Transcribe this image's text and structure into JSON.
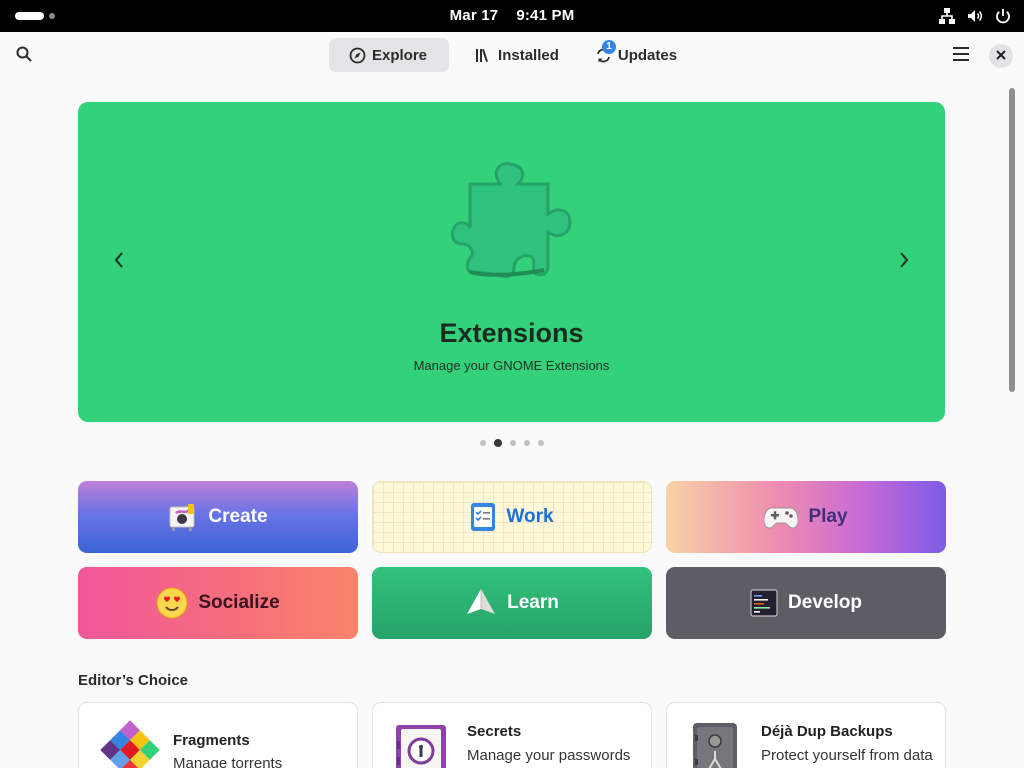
{
  "system_bar": {
    "date": "Mar 17",
    "time": "9:41 PM"
  },
  "header": {
    "tabs": [
      {
        "label": "Explore",
        "icon": "compass-icon",
        "active": true
      },
      {
        "label": "Installed",
        "icon": "library-icon",
        "active": false
      },
      {
        "label": "Updates",
        "icon": "refresh-icon",
        "active": false
      }
    ],
    "updates_badge": "1"
  },
  "carousel": {
    "title": "Extensions",
    "subtitle": "Manage your GNOME Extensions",
    "background": "#33d17a",
    "page_count": 5,
    "current_page": 2
  },
  "categories": [
    {
      "label": "Create",
      "icon": "paint-icon"
    },
    {
      "label": "Work",
      "icon": "checklist-icon"
    },
    {
      "label": "Play",
      "icon": "gamepad-icon"
    },
    {
      "label": "Socialize",
      "icon": "heart-eyes-emoji-icon"
    },
    {
      "label": "Learn",
      "icon": "paper-plane-icon"
    },
    {
      "label": "Develop",
      "icon": "terminal-icon"
    }
  ],
  "editors_choice": {
    "title": "Editor’s Choice",
    "apps": [
      {
        "name": "Fragments",
        "description": "Manage torrents",
        "icon": "fragments-icon"
      },
      {
        "name": "Secrets",
        "description": "Manage your passwords",
        "icon": "secrets-icon"
      },
      {
        "name": "Déjà Dup Backups",
        "description": "Protect yourself from data loss",
        "icon": "deja-dup-icon"
      }
    ]
  }
}
